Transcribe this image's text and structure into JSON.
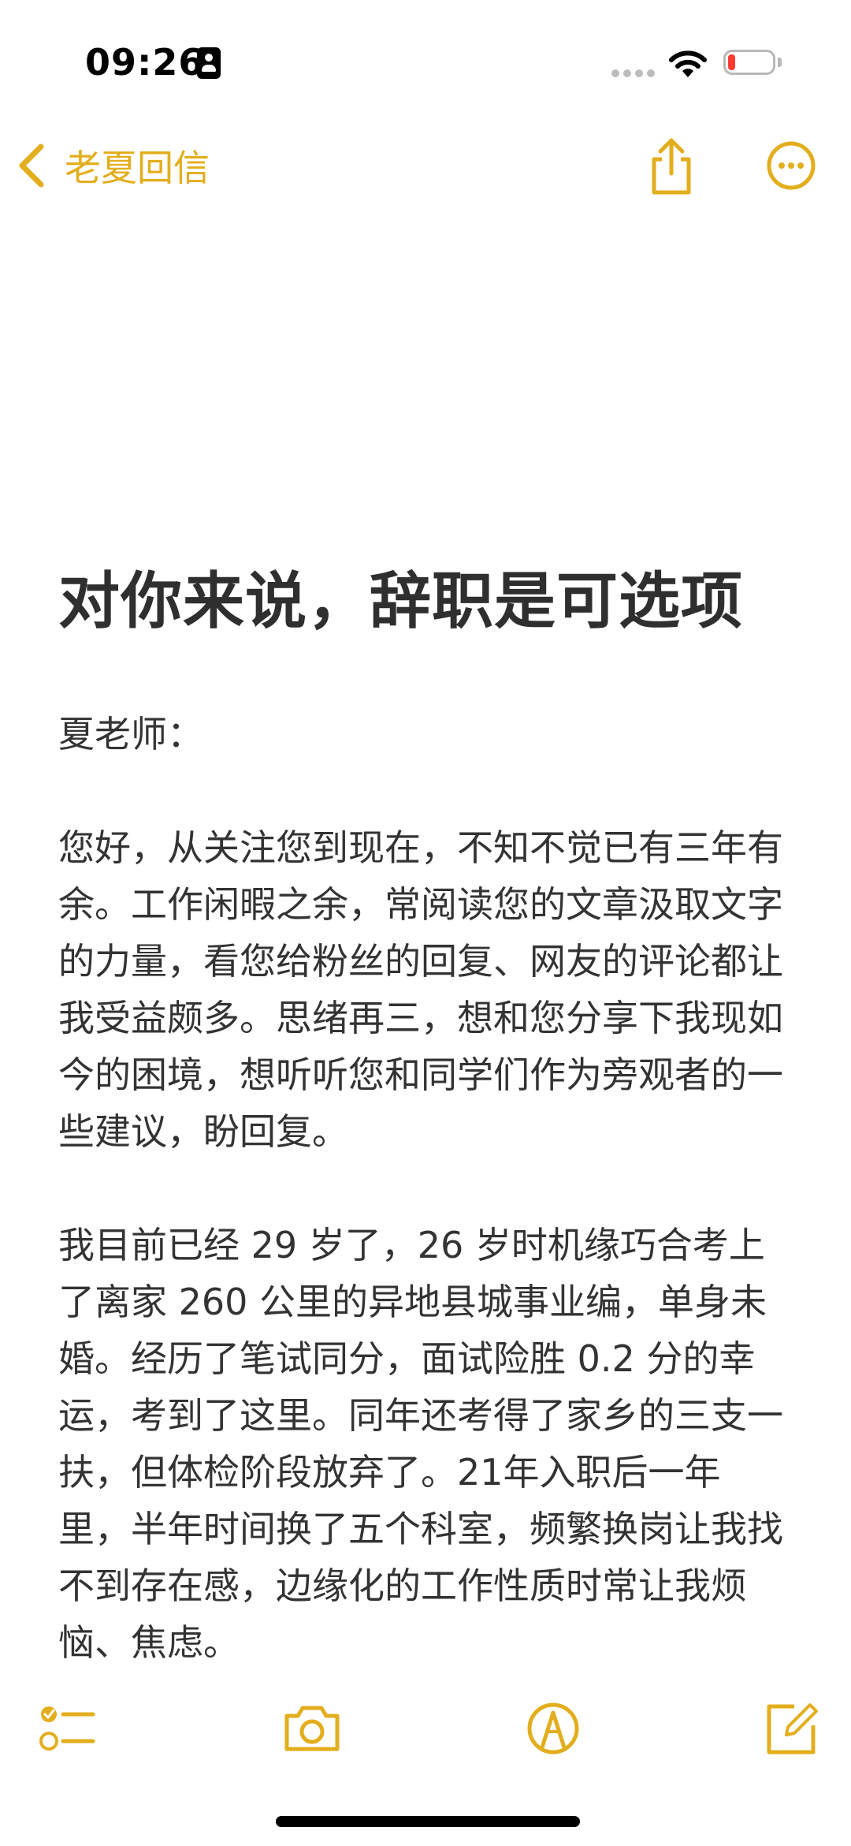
{
  "status_bar": {
    "time": "09:26"
  },
  "nav": {
    "back_label": "老夏回信",
    "icons": [
      "chevron-left-icon",
      "share-icon",
      "more-icon"
    ]
  },
  "article": {
    "title": "对你来说，辞职是可选项",
    "paragraphs": [
      "夏老师：",
      "您好，从关注您到现在，不知不觉已有三年有余。工作闲暇之余，常阅读您的文章汲取文字的力量，看您给粉丝的回复、网友的评论都让我受益颇多。思绪再三，想和您分享下我现如今的困境，想听听您和同学们作为旁观者的一些建议，盼回复。",
      "我目前已经 29 岁了，26 岁时机缘巧合考上了离家 260 公里的异地县城事业编，单身未婚。经历了笔试同分，面试险胜 0.2 分的幸运，考到了这里。同年还考得了家乡的三支一扶，但体检阶段放弃了。21年入职后一年里，半年时间换了五个科室，频繁换岗让我找不到存在感，边缘化的工作性质时常让我烦恼、焦虑。"
    ]
  },
  "toolbar": {
    "icons": [
      "checklist-icon",
      "camera-icon",
      "markup-pen-icon",
      "compose-icon"
    ]
  },
  "colors": {
    "accent": "#e3ae1d",
    "text": "#333333",
    "battery_low": "#ff3b30"
  }
}
